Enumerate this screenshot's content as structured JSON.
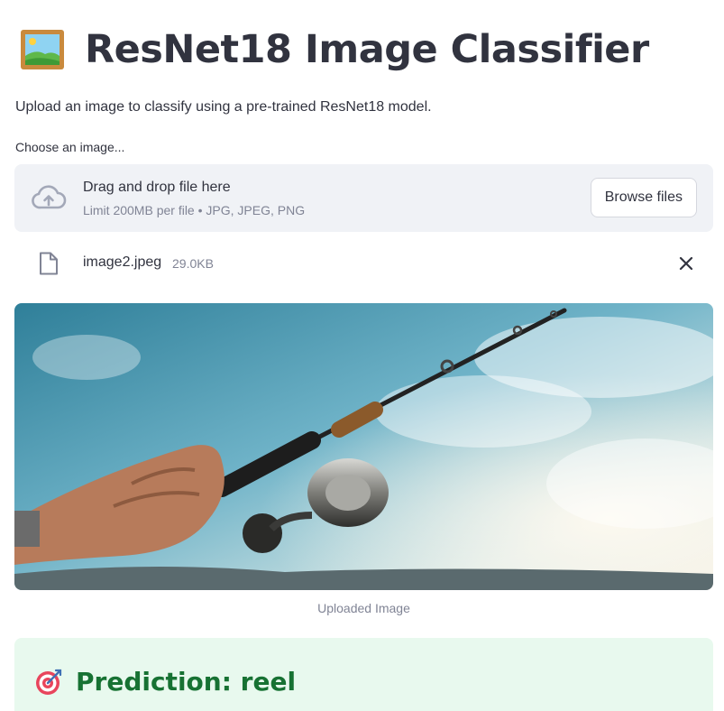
{
  "header": {
    "title": "ResNet18 Image Classifier",
    "icon": "framed-picture-icon"
  },
  "subtitle": "Upload an image to classify using a pre-trained ResNet18 model.",
  "uploader": {
    "label": "Choose an image...",
    "drop_text": "Drag and drop file here",
    "limit_text": "Limit 200MB per file • JPG, JPEG, PNG",
    "browse_label": "Browse files",
    "icon": "cloud-upload-icon"
  },
  "file": {
    "name": "image2.jpeg",
    "size": "29.0KB",
    "icon": "file-icon",
    "remove_icon": "close-icon"
  },
  "image": {
    "caption": "Uploaded Image"
  },
  "result": {
    "prediction": "Prediction: reel",
    "icon": "target-icon"
  },
  "colors": {
    "text": "#31333f",
    "muted": "#808495",
    "dropzone_bg": "#f0f2f6",
    "success_bg": "#e8f9ee",
    "success_text": "#177233"
  }
}
